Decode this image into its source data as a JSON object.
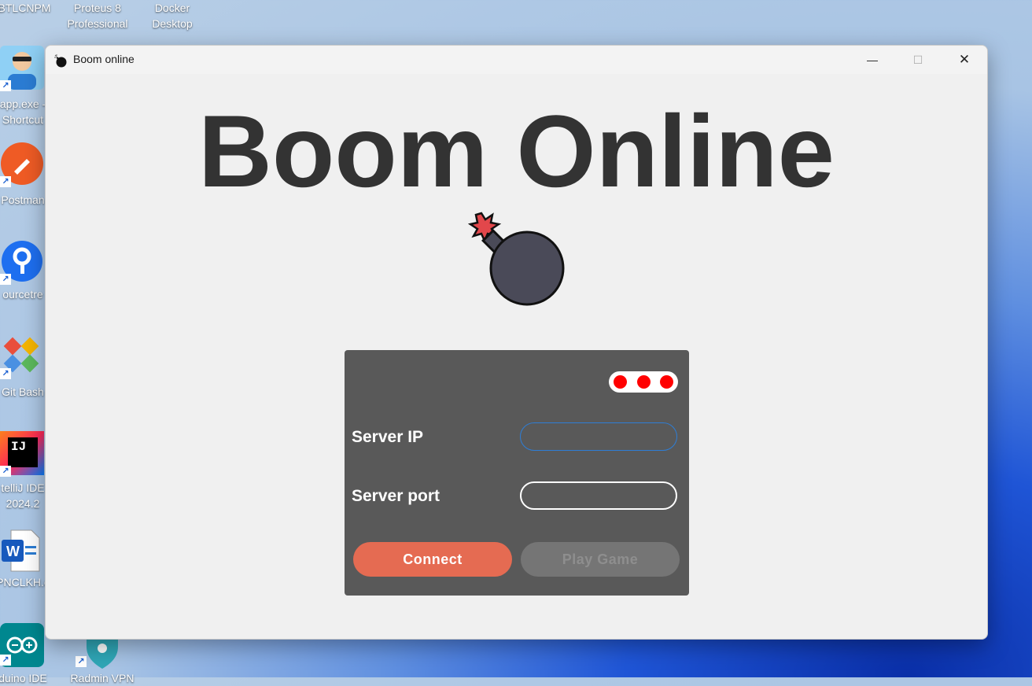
{
  "desktop": {
    "top_icons": [
      {
        "label": "BTLCNPM"
      },
      {
        "label": "Proteus 8\nProfessional"
      },
      {
        "label": "Docker\nDesktop"
      }
    ],
    "left_icons": [
      {
        "label": "app.exe -\nShortcut",
        "icon": "person-avatar-icon"
      },
      {
        "label": "Postman",
        "icon": "postman-icon"
      },
      {
        "label": "ourcetre",
        "icon": "sourcetree-icon"
      },
      {
        "label": "Git Bash",
        "icon": "git-bash-icon"
      },
      {
        "label": "telliJ IDE\n2024.2",
        "icon": "intellij-icon"
      },
      {
        "label": "PNCLKH.c",
        "icon": "word-doc-icon"
      },
      {
        "label": "duino IDE",
        "icon": "arduino-icon"
      }
    ],
    "bottom_partial": {
      "label": "Radmin VPN"
    }
  },
  "window": {
    "title": "Boom online",
    "icon": "bomb-icon",
    "controls": {
      "minimize": "—",
      "maximize": "☐",
      "close": "✕"
    }
  },
  "app": {
    "title": "Boom Online",
    "logo": "bomb-illustration",
    "status_dots": 3,
    "status_color": "#ff0000",
    "form": {
      "server_ip_label": "Server IP",
      "server_ip_value": "",
      "server_port_label": "Server port",
      "server_port_value": ""
    },
    "buttons": {
      "connect": "Connect",
      "play_game": "Play Game"
    }
  },
  "colors": {
    "panel": "#595959",
    "connect_button": "#e56b52",
    "play_button_disabled": "#757575",
    "title_text": "#333333"
  }
}
